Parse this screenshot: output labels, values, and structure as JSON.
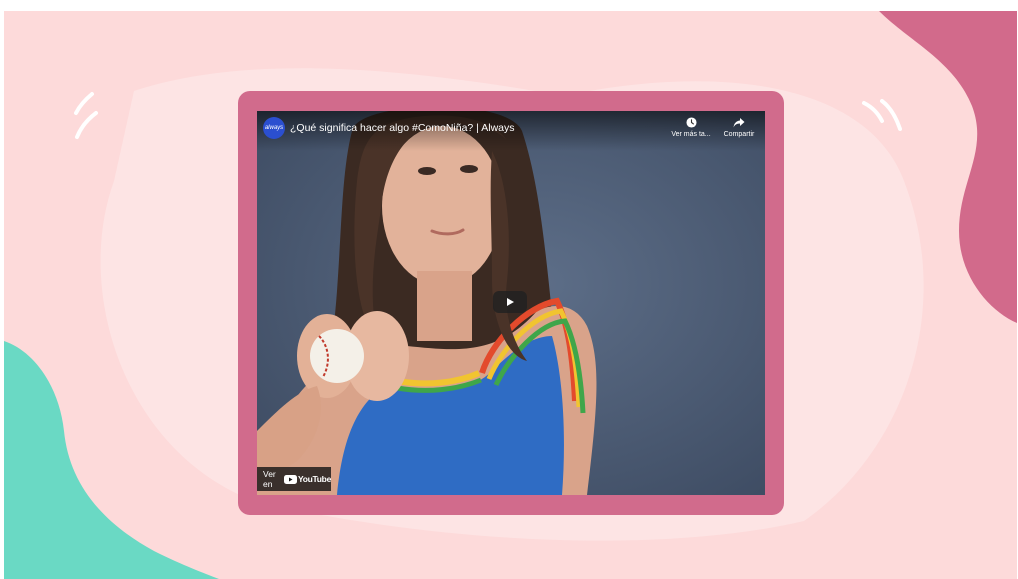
{
  "video": {
    "channel_logo_text": "always",
    "title": "¿Qué significa hacer algo #ComoNiña? | Always",
    "watch_later_label": "Ver más ta...",
    "share_label": "Compartir",
    "watch_on_prefix": "Ver en",
    "youtube_wordmark": "YouTube"
  },
  "colors": {
    "background": "#fddada",
    "frame": "#d16b8c",
    "blob_pink": "#d26a8b",
    "blob_teal": "#6ad9c4",
    "channel_blue": "#2b4fd0"
  },
  "icons": {
    "watch_later": "clock-icon",
    "share": "share-arrow-icon",
    "play": "play-icon",
    "youtube": "youtube-logo-icon"
  }
}
